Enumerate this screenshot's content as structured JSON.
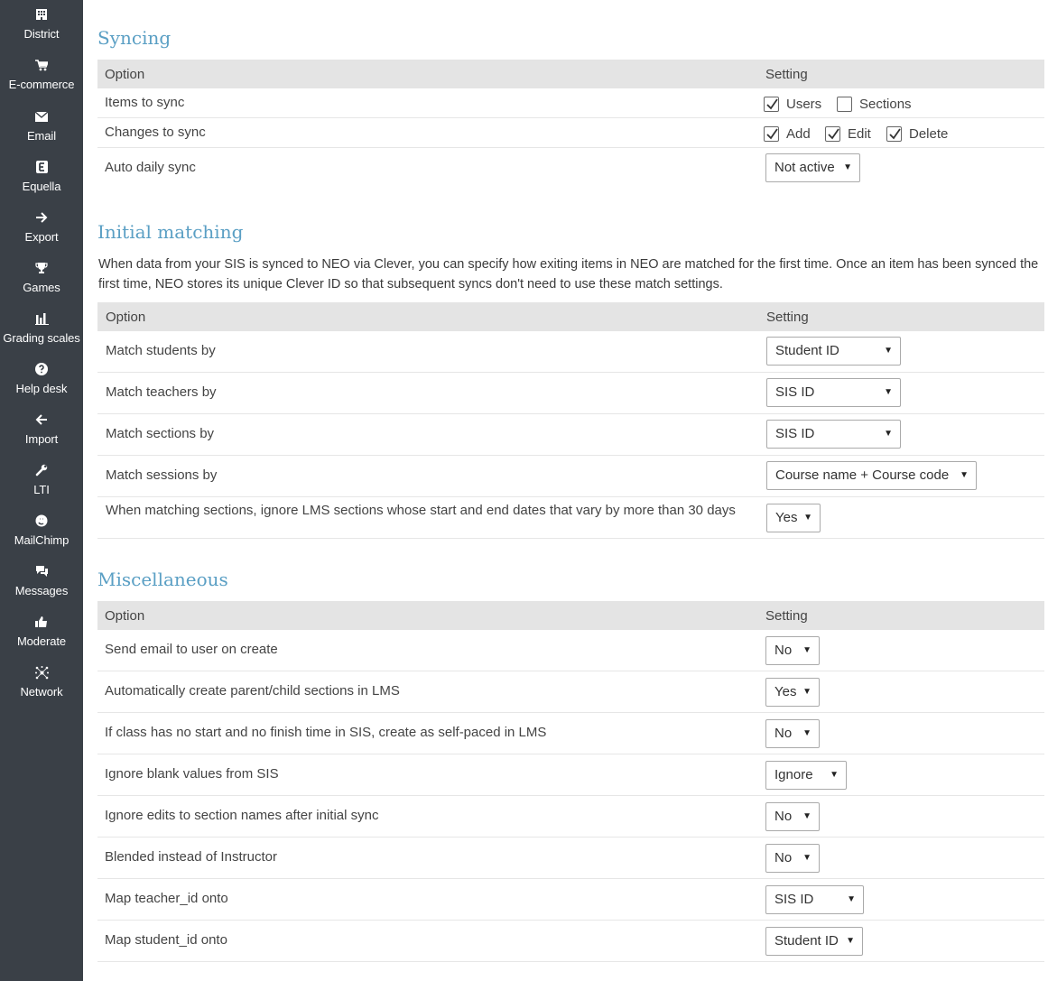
{
  "sidebar": {
    "items": [
      {
        "label": "District",
        "icon": "building-icon"
      },
      {
        "label": "E-commerce",
        "icon": "cart-icon"
      },
      {
        "label": "Email",
        "icon": "envelope-icon"
      },
      {
        "label": "Equella",
        "icon": "equella-icon"
      },
      {
        "label": "Export",
        "icon": "arrow-right-icon"
      },
      {
        "label": "Games",
        "icon": "trophy-icon"
      },
      {
        "label": "Grading scales",
        "icon": "bar-chart-icon"
      },
      {
        "label": "Help desk",
        "icon": "question-icon"
      },
      {
        "label": "Import",
        "icon": "arrow-left-icon"
      },
      {
        "label": "LTI",
        "icon": "wrench-icon"
      },
      {
        "label": "MailChimp",
        "icon": "mailchimp-icon"
      },
      {
        "label": "Messages",
        "icon": "chat-icon"
      },
      {
        "label": "Moderate",
        "icon": "thumbs-up-icon"
      },
      {
        "label": "Network",
        "icon": "network-icon"
      }
    ]
  },
  "syncing": {
    "title": "Syncing",
    "col_option": "Option",
    "col_setting": "Setting",
    "items_to_sync": {
      "label": "Items to sync",
      "users": "Users",
      "users_checked": true,
      "sections": "Sections",
      "sections_checked": false
    },
    "changes_to_sync": {
      "label": "Changes to sync",
      "add": "Add",
      "edit": "Edit",
      "delete": "Delete"
    },
    "auto_daily_sync": {
      "label": "Auto daily sync",
      "value": "Not active"
    }
  },
  "initial_matching": {
    "title": "Initial matching",
    "description": "When data from your SIS is synced to NEO via Clever, you can specify how exiting items in NEO are matched for the first time. Once an item has been synced the first time, NEO stores its unique Clever ID so that subsequent syncs don't need to use these match settings.",
    "col_option": "Option",
    "col_setting": "Setting",
    "rows": [
      {
        "label": "Match students by",
        "value": "Student ID"
      },
      {
        "label": "Match teachers by",
        "value": "SIS ID"
      },
      {
        "label": "Match sections by",
        "value": "SIS ID"
      },
      {
        "label": "Match sessions by",
        "value": "Course name + Course code"
      },
      {
        "label": "When matching sections, ignore LMS sections whose start and end dates that vary by more than 30 days",
        "value": "Yes"
      }
    ]
  },
  "miscellaneous": {
    "title": "Miscellaneous",
    "col_option": "Option",
    "col_setting": "Setting",
    "rows": [
      {
        "label": "Send email to user on create",
        "value": "No"
      },
      {
        "label": "Automatically create parent/child sections in LMS",
        "value": "Yes"
      },
      {
        "label": "If class has no start and no finish time in SIS, create as self-paced in LMS",
        "value": "No"
      },
      {
        "label": "Ignore blank values from SIS",
        "value": "Ignore"
      },
      {
        "label": "Ignore edits to section names after initial sync",
        "value": "No"
      },
      {
        "label": "Blended instead of Instructor",
        "value": "No"
      },
      {
        "label": "Map teacher_id onto",
        "value": "SIS ID"
      },
      {
        "label": "Map student_id onto",
        "value": "Student ID"
      }
    ]
  },
  "colors": {
    "sidebar_bg": "#3a4047",
    "heading": "#5a9fc4",
    "table_header_bg": "#e4e4e4"
  }
}
